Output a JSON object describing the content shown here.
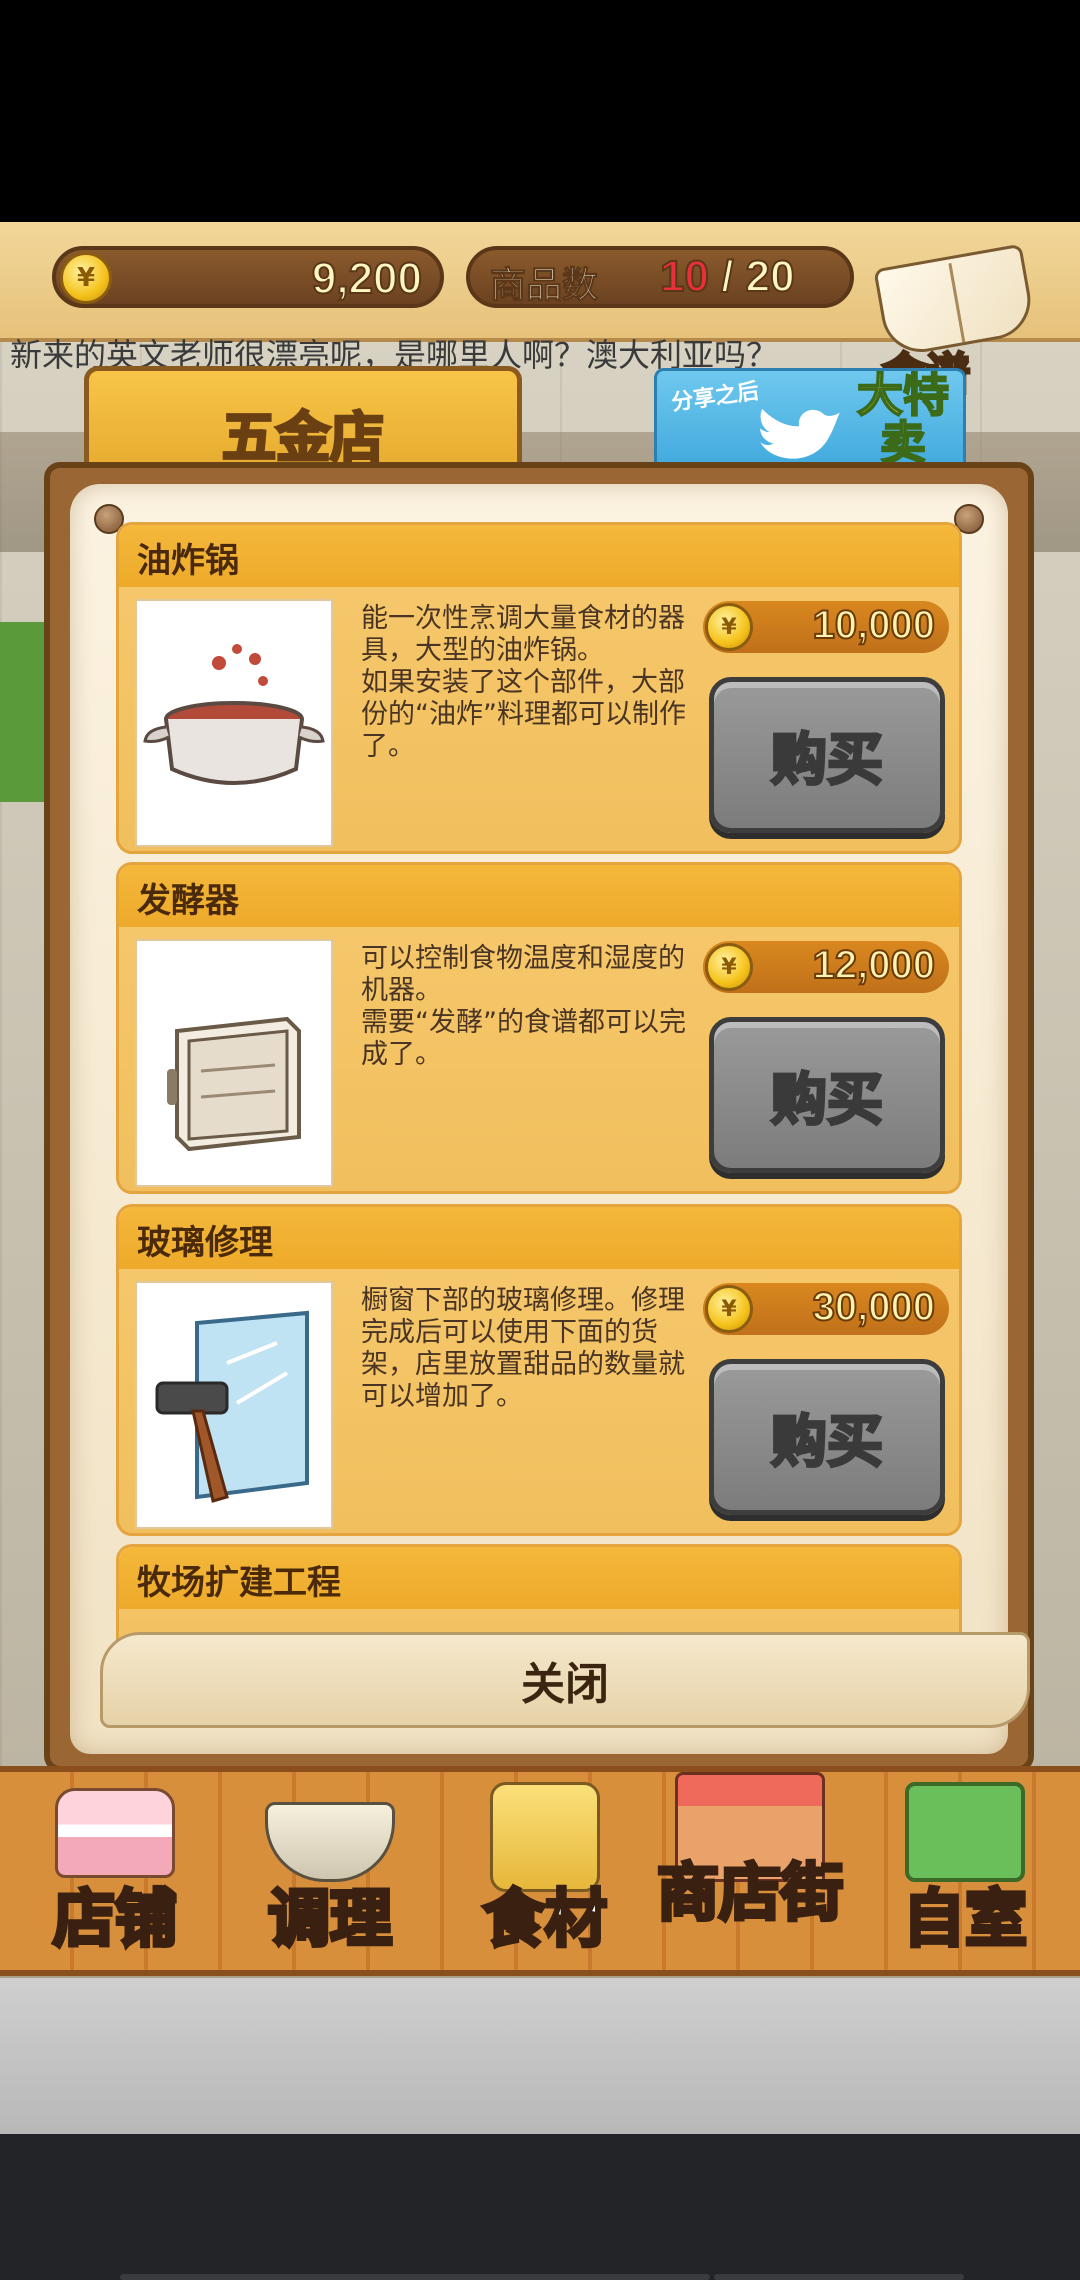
{
  "hud": {
    "coins": "9,200",
    "goods_label": "商品数",
    "goods_current": "10",
    "goods_sep": "/",
    "goods_max": "20",
    "recipe_label": "食谱"
  },
  "marquee": "新来的英文老师很漂亮呢，是哪里人啊？澳大利亚吗？",
  "panel": {
    "title": "五金店",
    "share": {
      "small": "分享之后",
      "big": "大特卖\n开始"
    },
    "close_label": "关闭"
  },
  "items": [
    {
      "name": "油炸锅",
      "desc": "能一次性烹调大量食材的器具，大型的油炸锅。\n如果安装了这个部件，大部份的“油炸”料理都可以制作了。",
      "price": "10,000",
      "buy_label": "购买",
      "icon": "fryer-pot-icon"
    },
    {
      "name": "发酵器",
      "desc": "可以控制食物温度和湿度的机器。\n需要“发酵”的食谱都可以完成了。",
      "price": "12,000",
      "buy_label": "购买",
      "icon": "proofer-cabinet-icon"
    },
    {
      "name": "玻璃修理",
      "desc": "橱窗下部的玻璃修理。修理完成后可以使用下面的货架，店里放置甜品的数量就可以增加了。",
      "price": "30,000",
      "buy_label": "购买",
      "icon": "glass-hammer-icon"
    },
    {
      "name": "牧场扩建工程"
    }
  ],
  "nav": [
    {
      "label": "店铺",
      "icon": "cake-icon"
    },
    {
      "label": "调理",
      "icon": "mixing-bowl-icon"
    },
    {
      "label": "食材",
      "icon": "ingredient-bag-icon"
    },
    {
      "label": "商店街",
      "icon": "storefront-icon"
    },
    {
      "label": "自室",
      "icon": "staff-only-sign-icon"
    }
  ],
  "colors": {
    "panel_gold": "#f4b83b",
    "buy_gray": "#8a8a8a",
    "price_orange": "#d9881e",
    "count_red": "#e8303a"
  }
}
